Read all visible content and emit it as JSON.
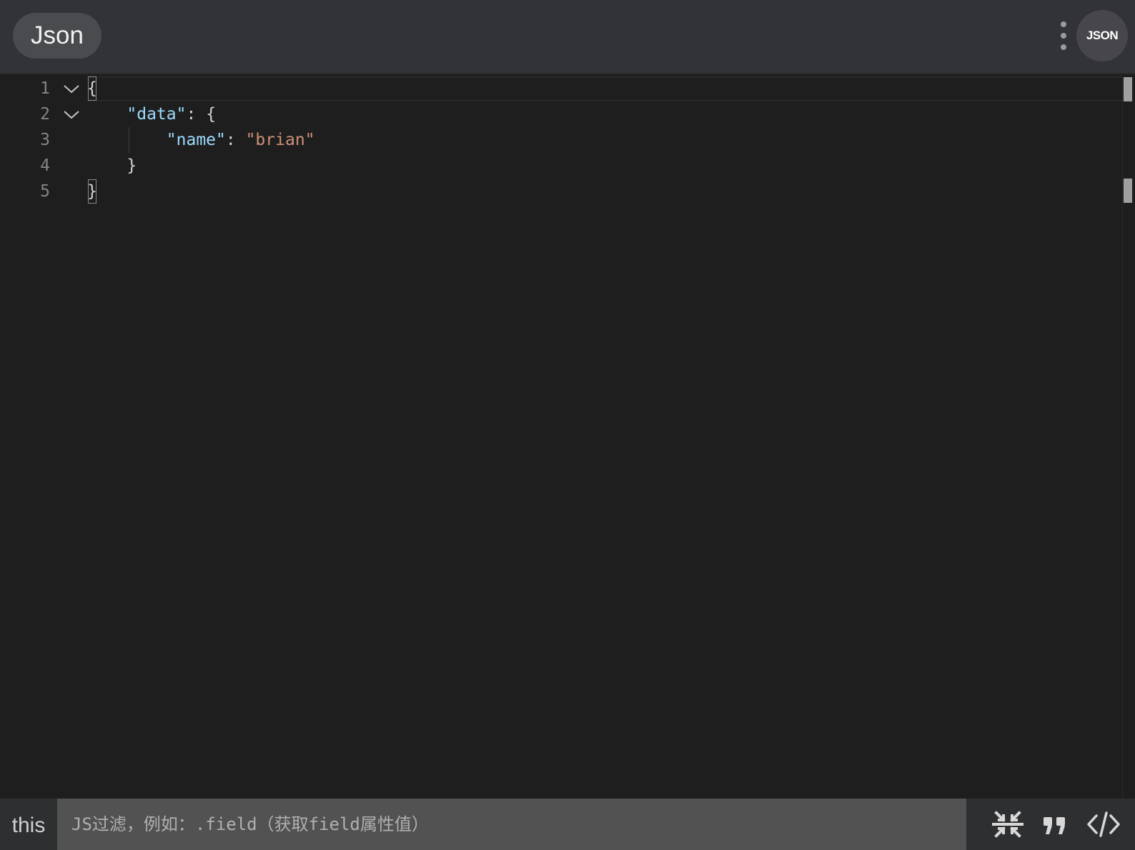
{
  "header": {
    "title": "Json",
    "avatar_label": "JSON"
  },
  "editor": {
    "lines": [
      {
        "number": "1",
        "foldable": true
      },
      {
        "number": "2",
        "foldable": true
      },
      {
        "number": "3",
        "foldable": false
      },
      {
        "number": "4",
        "foldable": false
      },
      {
        "number": "5",
        "foldable": false
      }
    ],
    "code": {
      "open_brace": "{",
      "data_key": "\"data\"",
      "colon": ": ",
      "data_open": "{",
      "name_key": "\"name\"",
      "name_value": "\"brian\"",
      "data_close": "}",
      "close_brace": "}"
    }
  },
  "footer": {
    "this_label": "this",
    "filter_placeholder": "JS过滤，例如：.field（获取field属性值）",
    "filter_value": ""
  },
  "colors": {
    "key": "#9cdcfe",
    "string": "#ce9178",
    "background": "#1e1e1e",
    "header": "#323336"
  },
  "icons": [
    "kebab-menu-icon",
    "chevron-down-icon",
    "compress-icon",
    "quote-icon",
    "code-icon"
  ]
}
